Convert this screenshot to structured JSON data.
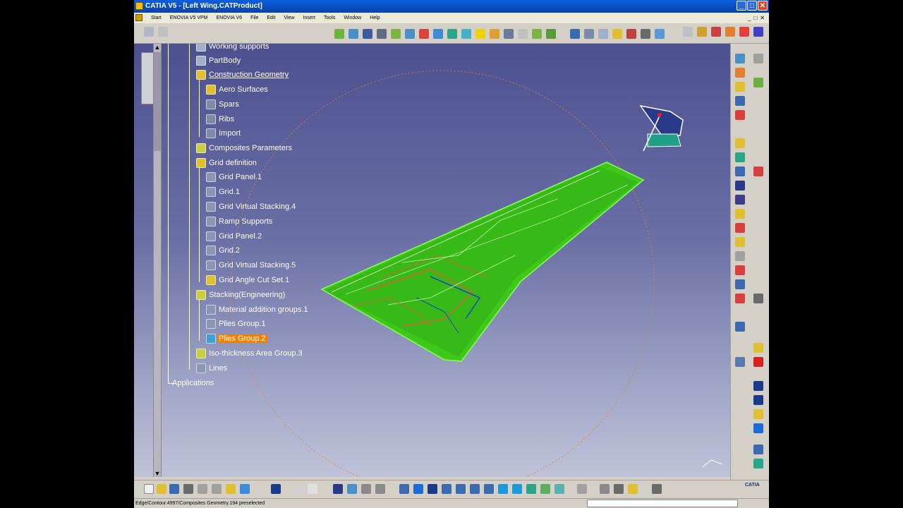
{
  "window": {
    "title": "CATIA V5 - [Left Wing.CATProduct]",
    "buttons": {
      "minimize": "_",
      "maximize": "□",
      "close": "✕"
    }
  },
  "menu": {
    "items": [
      "Start",
      "ENOVIA V5 VPM",
      "ENOVIA V6",
      "File",
      "Edit",
      "View",
      "Insert",
      "Tools",
      "Window",
      "Help"
    ],
    "controls": [
      "_",
      "□",
      "✕"
    ]
  },
  "tree": {
    "nodes": [
      {
        "label": "Working supports",
        "icon": "part"
      },
      {
        "label": "PartBody",
        "icon": "part"
      },
      {
        "label": "Construction Geometry",
        "icon": "geom",
        "underline": true
      },
      {
        "label": "Aero Surfaces",
        "icon": "geom"
      },
      {
        "label": "Spars",
        "icon": "set"
      },
      {
        "label": "Ribs",
        "icon": "set"
      },
      {
        "label": "Import",
        "icon": "set"
      },
      {
        "label": "Composites Parameters",
        "icon": "comp"
      },
      {
        "label": "Grid definition",
        "icon": "geom"
      },
      {
        "label": "Grid Panel.1",
        "icon": "grid"
      },
      {
        "label": "Grid.1",
        "icon": "grid"
      },
      {
        "label": "Grid Virtual Stacking.4",
        "icon": "grid"
      },
      {
        "label": "Ramp Supports",
        "icon": "grid"
      },
      {
        "label": "Grid Panel.2",
        "icon": "grid"
      },
      {
        "label": "Grid.2",
        "icon": "grid"
      },
      {
        "label": "Grid Virtual Stacking.5",
        "icon": "grid"
      },
      {
        "label": "Grid Angle Cut Set.1",
        "icon": "geom"
      },
      {
        "label": "Stacking(Engineering)",
        "icon": "comp"
      },
      {
        "label": "Material addition groups.1",
        "icon": "grid"
      },
      {
        "label": "Plies Group.1",
        "icon": "grid"
      },
      {
        "label": "Plies Group.2",
        "icon": "ply",
        "selected": true
      },
      {
        "label": "Iso-thickness Area Group.3",
        "icon": "comp"
      },
      {
        "label": "Lines",
        "icon": "grid"
      },
      {
        "label": "Applications",
        "icon": "none"
      }
    ]
  },
  "status": {
    "text": "Edge/Contour.4997/Composites Geometry.194 preselected"
  },
  "logo": {
    "text": "CATIA"
  },
  "colors": {
    "wing": "#3ec81a",
    "selected": "#f08000",
    "canvas_top": "#4d5090",
    "canvas_bottom": "#bfc2d8"
  }
}
